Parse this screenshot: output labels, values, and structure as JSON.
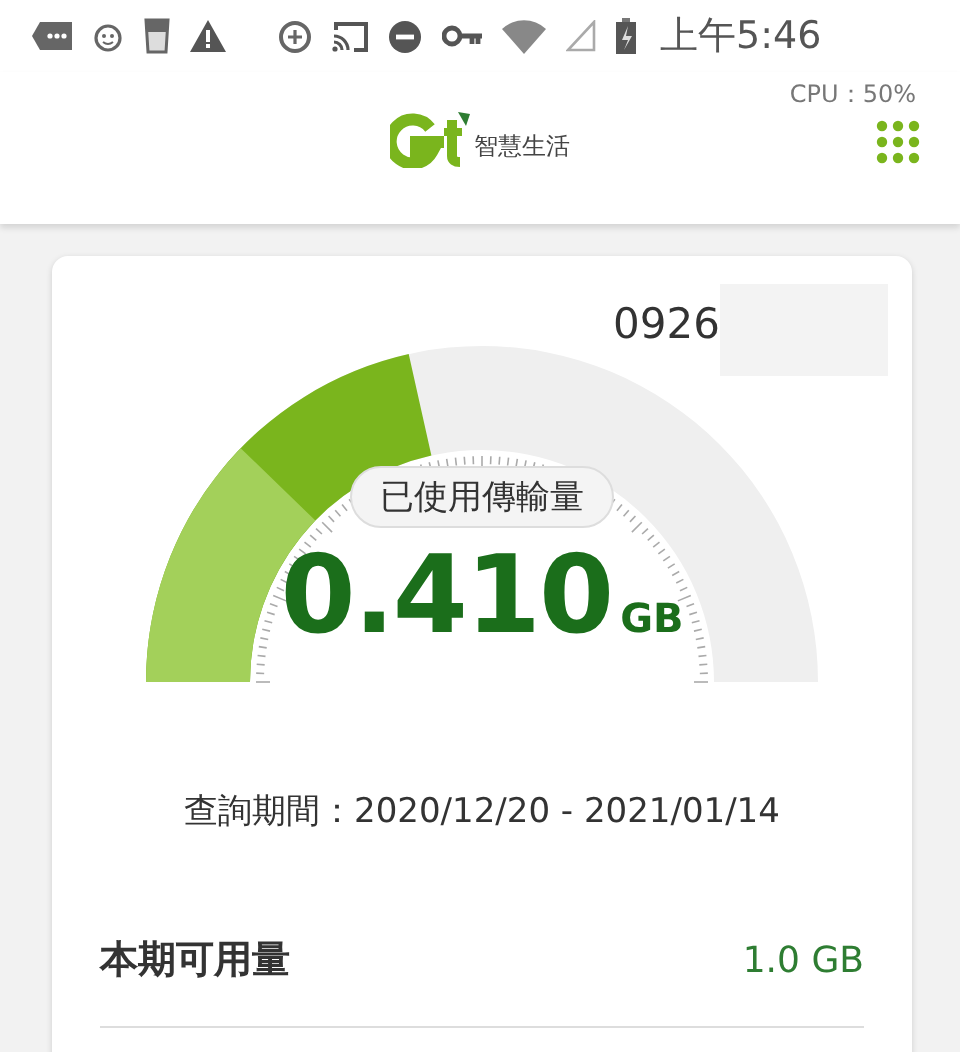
{
  "status_bar": {
    "time": "上午5:46"
  },
  "cpu": "CPU：50%",
  "header": {
    "logo_text": "智慧生活"
  },
  "card": {
    "phone": "0926",
    "gauge": {
      "label": "已使用傳輸量",
      "value": "0.410",
      "unit": "GB",
      "segments": [
        {
          "level": 0.245,
          "color": "#a3d05a"
        },
        {
          "level": 0.43,
          "color": "#7ab51d"
        }
      ]
    },
    "period": "查詢期間：2020/12/20 - 2021/01/14",
    "rows": [
      {
        "label": "本期可用量",
        "value": "1.0 GB"
      }
    ]
  }
}
